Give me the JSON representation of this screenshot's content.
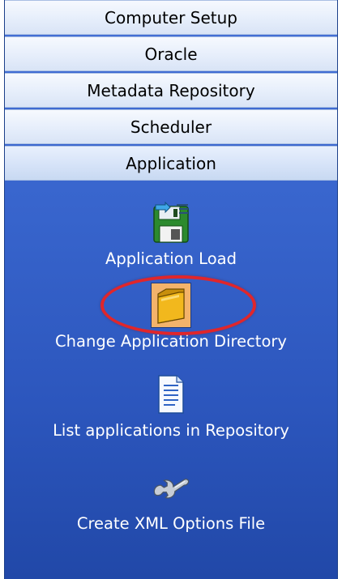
{
  "sections": [
    {
      "label": "Computer Setup"
    },
    {
      "label": "Oracle"
    },
    {
      "label": "Metadata Repository"
    },
    {
      "label": "Scheduler"
    },
    {
      "label": "Application"
    }
  ],
  "items": [
    {
      "label": "Application Load",
      "icon": "floppy-disk-icon"
    },
    {
      "label": "Change Application Directory",
      "icon": "folder-icon"
    },
    {
      "label": "List applications in Repository",
      "icon": "document-list-icon"
    },
    {
      "label": "Create XML Options File",
      "icon": "wrench-icon"
    }
  ],
  "colors": {
    "panel": "#3865cd",
    "header": "#e6eefb",
    "selection": "#f3b36b",
    "highlight_circle": "#e0262b"
  }
}
